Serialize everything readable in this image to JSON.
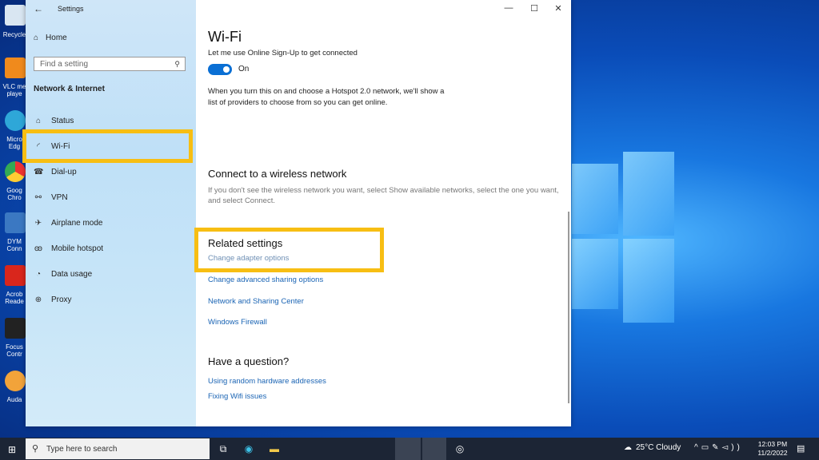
{
  "window": {
    "title": "Settings",
    "back_icon": "←",
    "minimize": "—",
    "maximize": "☐",
    "close": "✕"
  },
  "sidebar": {
    "home": "Home",
    "search_placeholder": "Find a setting",
    "section": "Network & Internet",
    "items": [
      {
        "label": "Status",
        "icon": "globe-icon",
        "glyph": "⌂"
      },
      {
        "label": "Wi-Fi",
        "icon": "wifi-icon",
        "glyph": "◜"
      },
      {
        "label": "Dial-up",
        "icon": "phone-icon",
        "glyph": "☎"
      },
      {
        "label": "VPN",
        "icon": "vpn-icon",
        "glyph": "⚯"
      },
      {
        "label": "Airplane mode",
        "icon": "airplane-icon",
        "glyph": "✈"
      },
      {
        "label": "Mobile hotspot",
        "icon": "hotspot-icon",
        "glyph": "((•))"
      },
      {
        "label": "Data usage",
        "icon": "data-usage-icon",
        "glyph": "◔"
      },
      {
        "label": "Proxy",
        "icon": "globe-icon",
        "glyph": "⊕"
      }
    ]
  },
  "main": {
    "title": "Wi-Fi",
    "cut_text": "Let me use Online Sign-Up to get connected",
    "toggle_state": "On",
    "hotspot_desc": "When you turn this on and choose a Hotspot 2.0 network, we'll show a list of providers to choose from so you can get online.",
    "connect_heading": "Connect to a wireless network",
    "connect_desc": "If you don't see the wireless network you want, select Show available networks, select the one you want, and select Connect.",
    "related_heading": "Related settings",
    "related_links": [
      "Change adapter options",
      "Change advanced sharing options",
      "Network and Sharing Center",
      "Windows Firewall"
    ],
    "question_heading": "Have a question?",
    "question_links": [
      "Using random hardware addresses",
      "Fixing Wifi issues"
    ]
  },
  "taskbar": {
    "search_placeholder": "Type here to search",
    "weather": "25°C Cloudy",
    "time": "12:03 PM",
    "date": "11/2/2022"
  },
  "desktop": {
    "labels": [
      "Recycle",
      "VLC me playe",
      "Micro Edg",
      "Goog Chro",
      "DYM Conn",
      "Acrob Reade",
      "Focus Contr",
      "Auda"
    ]
  },
  "colors": {
    "highlight": "#f7be13",
    "accent": "#0a6fd4",
    "link": "#1a64b4"
  }
}
